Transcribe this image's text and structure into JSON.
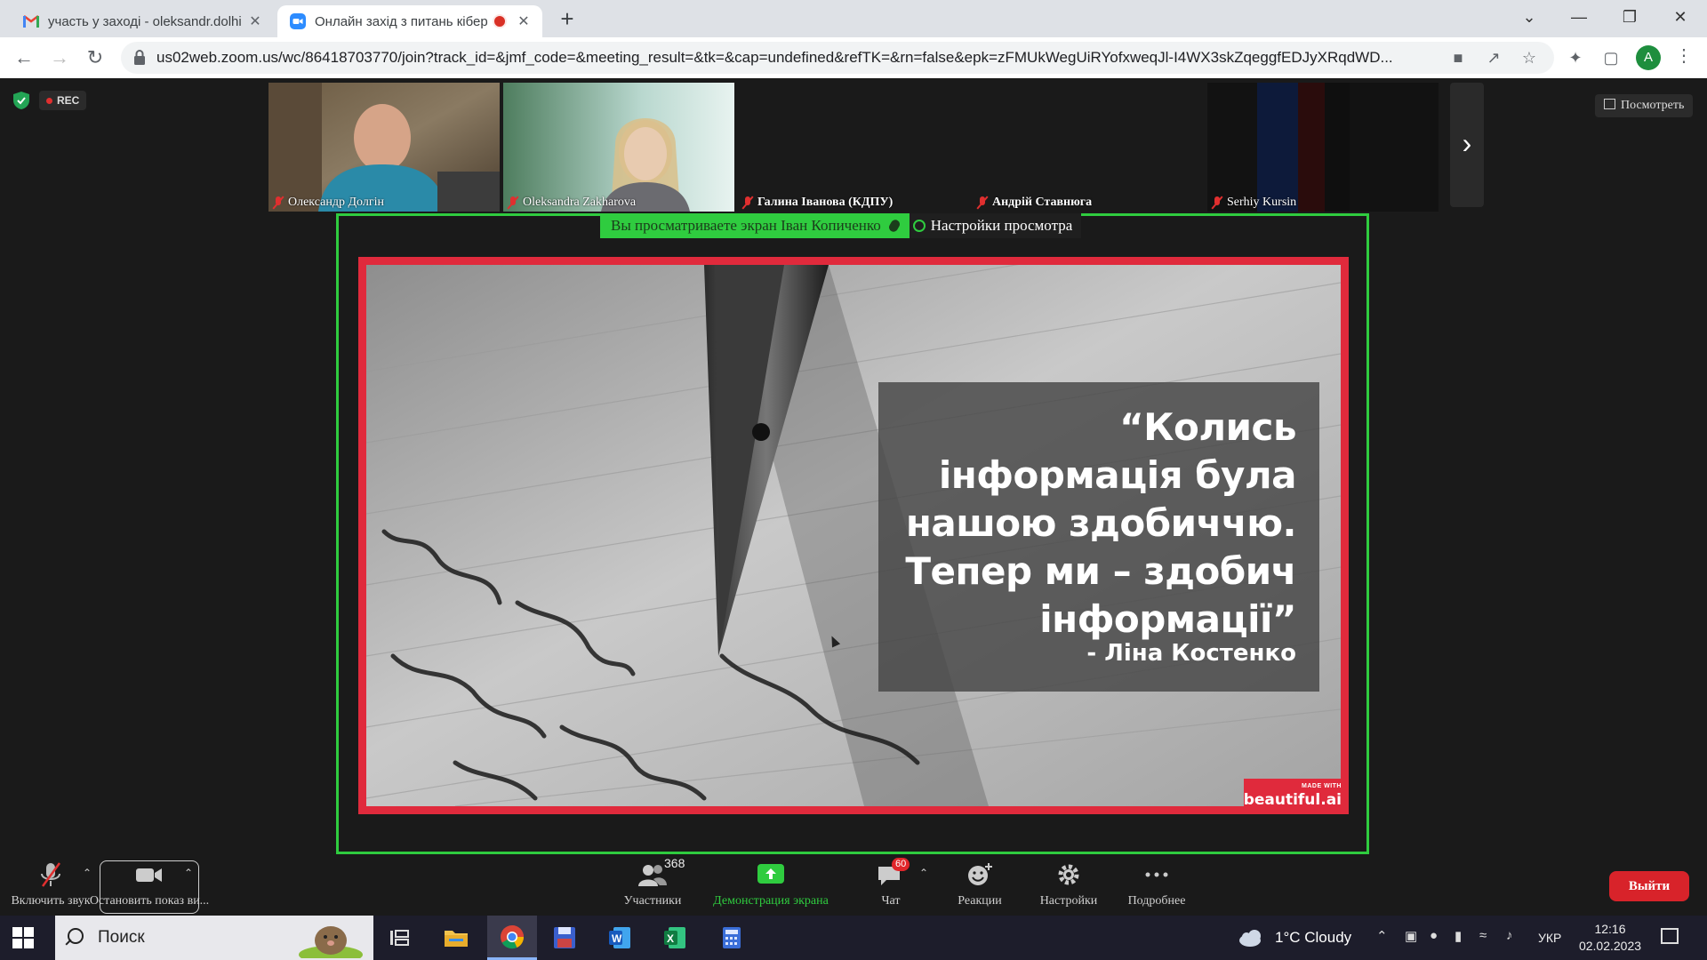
{
  "browser": {
    "tabs": [
      {
        "title": "участь у заході - oleksandr.dolhi",
        "close": "✕"
      },
      {
        "title": "Онлайн захід з питань кібер",
        "close": "✕"
      }
    ],
    "new_tab": "+",
    "window_controls": {
      "tab_search": "⌄",
      "minimize": "—",
      "restore": "❐",
      "close": "✕"
    },
    "url": "us02web.zoom.us/wc/86418703770/join?track_id=&jmf_code=&meeting_result=&tk=&cap=undefined&refTK=&rn=false&epk=zFMUkWegUiRYofxweqJl-I4WX3skZqeggfEDJyXRqdWD...",
    "profile_initial": "A"
  },
  "meeting": {
    "rec_label": "REC",
    "view_button": "Посмотреть",
    "participants": [
      {
        "name": "Олександр Долгін"
      },
      {
        "name": "Oleksandra Zakharova"
      },
      {
        "name": "Галина Іванова (КДПУ)"
      },
      {
        "name": "Андрій Ставнюга"
      },
      {
        "name": "Serhiy Kursin"
      }
    ],
    "share_banner": {
      "viewing_text": "Вы просматриваете экран Іван Копиченко",
      "view_settings": "Настройки просмотра"
    },
    "slide": {
      "quote_lines": [
        "“Колись",
        "інформація була",
        "нашою здобиччю.",
        "Тепер ми – здобич",
        "інформації”"
      ],
      "author": "- Ліна Костенко",
      "brand_small": "MADE WITH",
      "brand_name": "beautiful.ai"
    }
  },
  "footer": {
    "unmute_label": "Включить звук",
    "stop_video_label": "Остановить показ ви...",
    "participants_label": "Участники",
    "participants_count": "368",
    "share_label": "Демонстрация экрана",
    "chat_label": "Чат",
    "chat_badge": "60",
    "reactions_label": "Реакции",
    "settings_label": "Настройки",
    "more_label": "Подробнее",
    "leave_label": "Выйти"
  },
  "taskbar": {
    "search_text": "Поиск",
    "weather": "1°C  Cloudy",
    "language": "УКР",
    "time": "12:16",
    "date": "02.02.2023"
  },
  "colors": {
    "share_green": "#2fcc3f",
    "slide_red": "#e02a3c",
    "leave_red": "#d8232a"
  }
}
